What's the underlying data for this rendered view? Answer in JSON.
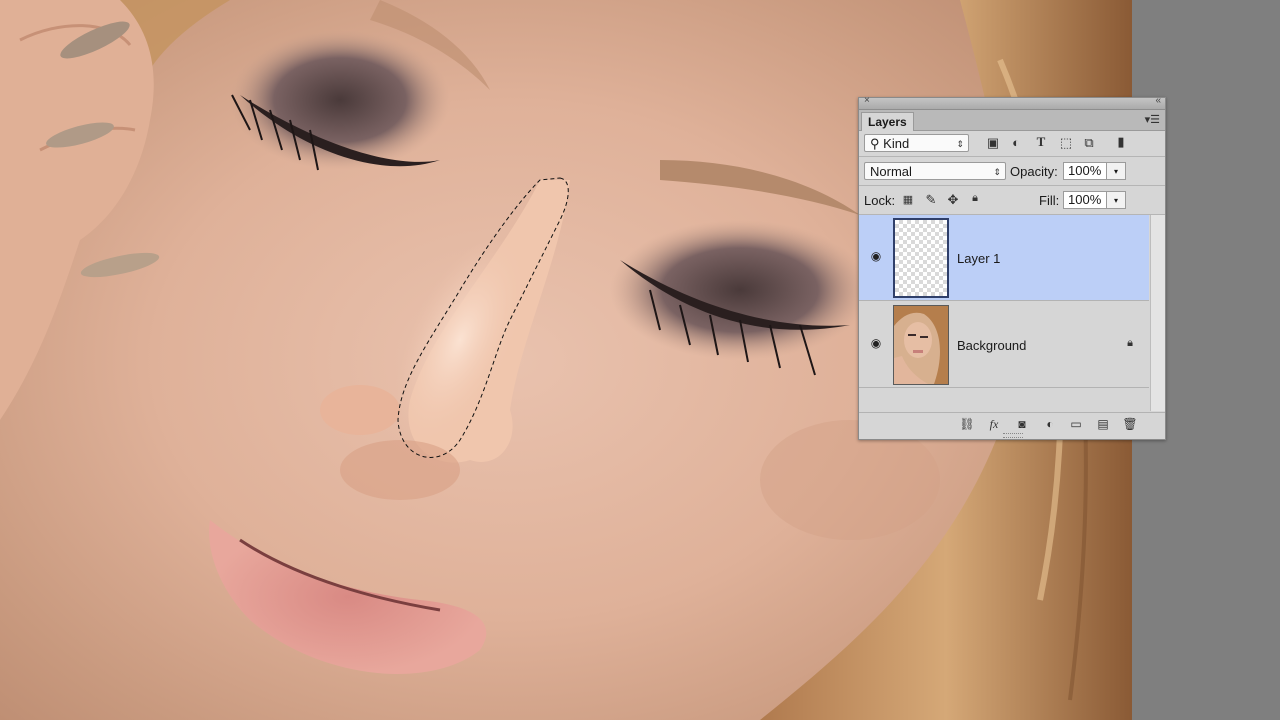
{
  "panel": {
    "tab_label": "Layers",
    "filter": {
      "value": "Kind",
      "icon": "search-icon"
    },
    "filter_icons": [
      "image-filter-icon",
      "adjustment-filter-icon",
      "type-filter-icon",
      "shape-filter-icon",
      "smart-object-filter-icon",
      "filter-toggle-icon"
    ],
    "blend_mode": "Normal",
    "opacity_label": "Opacity:",
    "opacity_value": "100%",
    "lock_label": "Lock:",
    "lock_icons": [
      "lock-transparent-pixels-icon",
      "lock-image-pixels-icon",
      "lock-position-icon",
      "lock-all-icon"
    ],
    "fill_label": "Fill:",
    "fill_value": "100%",
    "layers": [
      {
        "name": "Layer 1",
        "selected": true,
        "visible": true,
        "locked": false
      },
      {
        "name": "Background",
        "selected": false,
        "visible": true,
        "locked": true
      }
    ],
    "footer_icons": [
      "link-layers-icon",
      "fx-icon",
      "add-mask-icon",
      "new-adjustment-icon",
      "new-group-icon",
      "new-layer-icon",
      "trash-icon"
    ],
    "fx_label": "fx",
    "colors": {
      "selected_layer": "#bccff7",
      "panel_bg": "#d6d6d6",
      "pasteboard": "#7f7f7f"
    }
  }
}
